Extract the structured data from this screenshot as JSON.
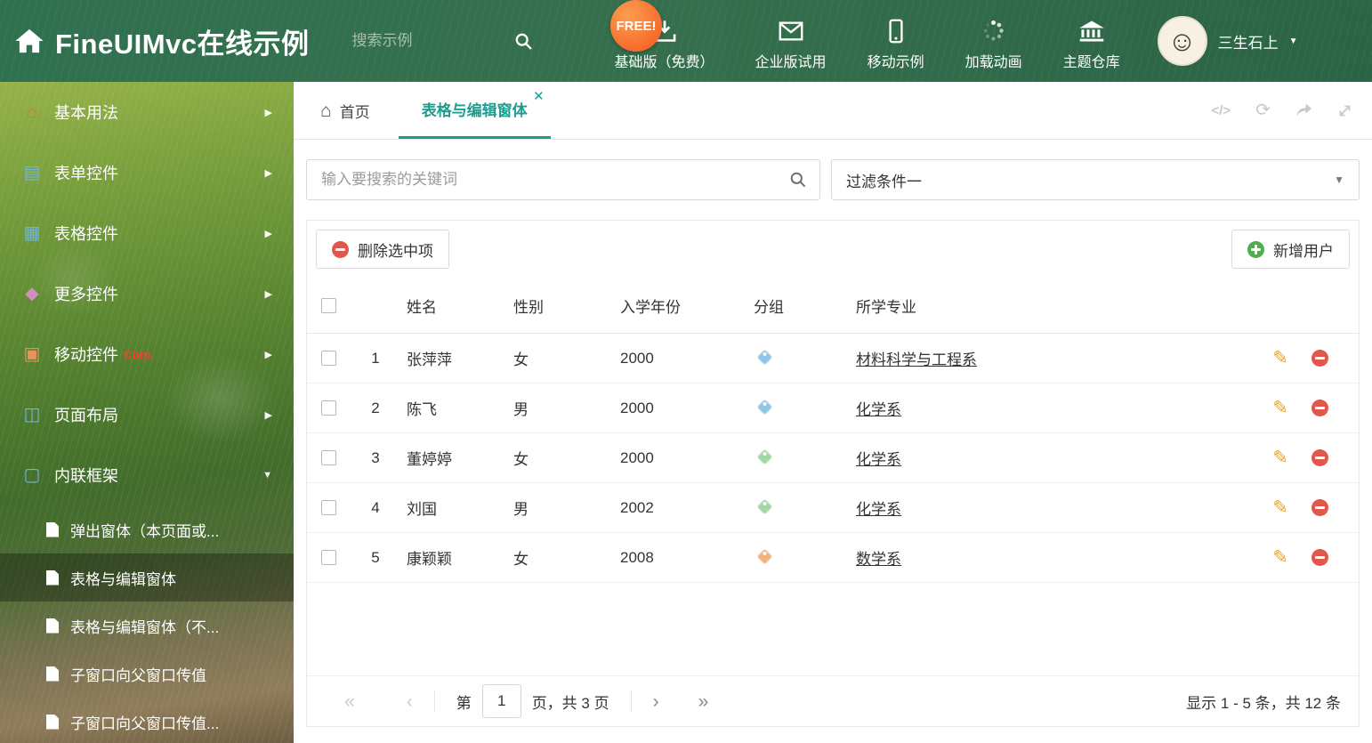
{
  "accent": "#1b9e8e",
  "header": {
    "title": "FineUIMvc在线示例",
    "search_placeholder": "搜索示例",
    "free_badge": "FREE!",
    "nav": [
      {
        "label": "基础版（免费）"
      },
      {
        "label": "企业版试用"
      },
      {
        "label": "移动示例"
      },
      {
        "label": "加载动画"
      },
      {
        "label": "主题仓库"
      }
    ],
    "user_name": "三生石上"
  },
  "sidebar": {
    "items": [
      {
        "label": "基本用法"
      },
      {
        "label": "表单控件"
      },
      {
        "label": "表格控件"
      },
      {
        "label": "更多控件"
      },
      {
        "label": "移动控件",
        "badge": "Corp."
      },
      {
        "label": "页面布局"
      },
      {
        "label": "内联框架"
      }
    ],
    "subitems": [
      {
        "label": "弹出窗体（本页面或..."
      },
      {
        "label": "表格与编辑窗体"
      },
      {
        "label": "表格与编辑窗体（不..."
      },
      {
        "label": "子窗口向父窗口传值"
      },
      {
        "label": "子窗口向父窗口传值..."
      }
    ]
  },
  "tabs": {
    "home": "首页",
    "active": "表格与编辑窗体"
  },
  "search": {
    "placeholder": "输入要搜索的关键词"
  },
  "filter": {
    "selected": "过滤条件一"
  },
  "toolbar": {
    "delete": "删除选中项",
    "add": "新增用户"
  },
  "table": {
    "headers": {
      "name": "姓名",
      "gender": "性别",
      "year": "入学年份",
      "group": "分组",
      "major": "所学专业"
    },
    "rows": [
      {
        "num": "1",
        "name": "张萍萍",
        "gender": "女",
        "year": "2000",
        "tag_color": "#8ec6e8",
        "major": "材料科学与工程系"
      },
      {
        "num": "2",
        "name": "陈飞",
        "gender": "男",
        "year": "2000",
        "tag_color": "#8ec6e8",
        "major": "化学系"
      },
      {
        "num": "3",
        "name": "董婷婷",
        "gender": "女",
        "year": "2000",
        "tag_color": "#a3d8a5",
        "major": "化学系"
      },
      {
        "num": "4",
        "name": "刘国",
        "gender": "男",
        "year": "2002",
        "tag_color": "#a3d8a5",
        "major": "化学系"
      },
      {
        "num": "5",
        "name": "康颖颖",
        "gender": "女",
        "year": "2008",
        "tag_color": "#f2b27c",
        "major": "数学系"
      }
    ]
  },
  "pager": {
    "page_prefix": "第",
    "page_value": "1",
    "page_suffix": "页，共 3 页",
    "summary": "显示 1 - 5 条，共 12 条"
  }
}
